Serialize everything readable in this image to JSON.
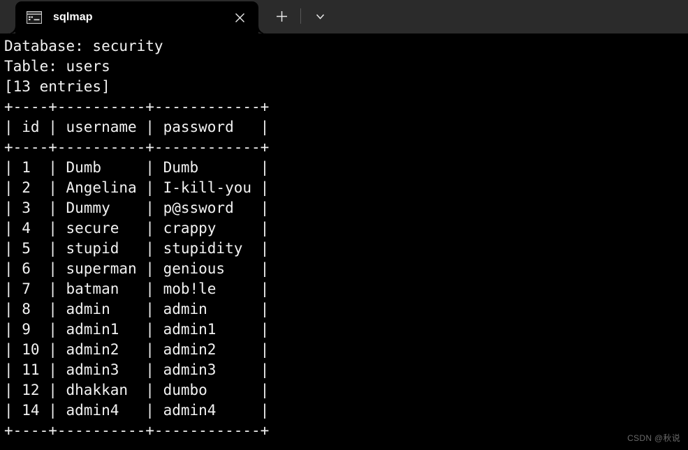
{
  "window": {
    "tab": {
      "title": "sqlmap",
      "icon": "console-window-icon",
      "close_label": "✕"
    },
    "actions": {
      "new_tab_label": "+",
      "dropdown_label": "⌄"
    },
    "colors": {
      "titlebar_bg": "#2b2b2b",
      "terminal_bg": "#000000",
      "terminal_fg": "#f2f2f2",
      "watermark_fg": "#6a6a6a"
    }
  },
  "terminal": {
    "database_line": "Database: security",
    "table_line": "Table: users",
    "entries_line": "[13 entries]",
    "separator": "+----+----------+------------+",
    "columns": [
      "id",
      "username",
      "password"
    ],
    "header_row": "| id | username | password   |",
    "rows": [
      {
        "id": "1",
        "username": "Dumb",
        "password": "Dumb"
      },
      {
        "id": "2",
        "username": "Angelina",
        "password": "I-kill-you"
      },
      {
        "id": "3",
        "username": "Dummy",
        "password": "p@ssword"
      },
      {
        "id": "4",
        "username": "secure",
        "password": "crappy"
      },
      {
        "id": "5",
        "username": "stupid",
        "password": "stupidity"
      },
      {
        "id": "6",
        "username": "superman",
        "password": "genious"
      },
      {
        "id": "7",
        "username": "batman",
        "password": "mob!le"
      },
      {
        "id": "8",
        "username": "admin",
        "password": "admin"
      },
      {
        "id": "9",
        "username": "admin1",
        "password": "admin1"
      },
      {
        "id": "10",
        "username": "admin2",
        "password": "admin2"
      },
      {
        "id": "11",
        "username": "admin3",
        "password": "admin3"
      },
      {
        "id": "12",
        "username": "dhakkan",
        "password": "dumbo"
      },
      {
        "id": "14",
        "username": "admin4",
        "password": "admin4"
      }
    ],
    "full_text": "Database: security\nTable: users\n[13 entries]\n+----+----------+------------+\n| id | username | password   |\n+----+----------+------------+\n| 1  | Dumb     | Dumb       |\n| 2  | Angelina | I-kill-you |\n| 3  | Dummy    | p@ssword   |\n| 4  | secure   | crappy     |\n| 5  | stupid   | stupidity  |\n| 6  | superman | genious    |\n| 7  | batman   | mob!le     |\n| 8  | admin    | admin      |\n| 9  | admin1   | admin1     |\n| 10 | admin2   | admin2     |\n| 11 | admin3   | admin3     |\n| 12 | dhakkan  | dumbo      |\n| 14 | admin4   | admin4     |\n+----+----------+------------+"
  },
  "watermark": {
    "text": "CSDN @秋说"
  }
}
